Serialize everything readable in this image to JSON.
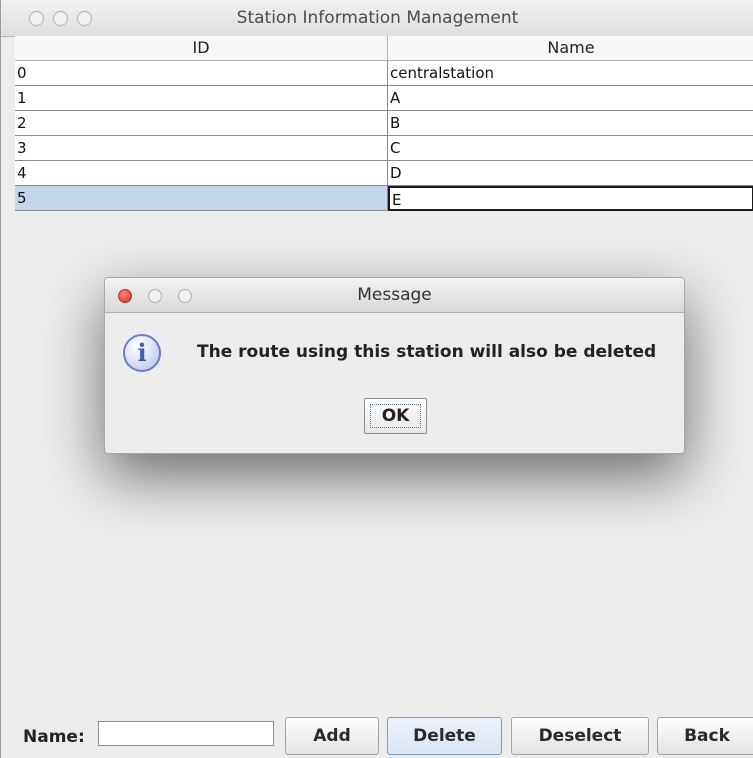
{
  "window": {
    "title": "Station Information Management"
  },
  "table": {
    "columns": [
      "ID",
      "Name"
    ],
    "rows": [
      {
        "id": "0",
        "name": "centralstation"
      },
      {
        "id": "1",
        "name": "A"
      },
      {
        "id": "2",
        "name": "B"
      },
      {
        "id": "3",
        "name": "C"
      },
      {
        "id": "4",
        "name": "D"
      },
      {
        "id": "5",
        "name": "E"
      }
    ],
    "selected_row": 5,
    "selection_color": "#c3d6ec"
  },
  "form": {
    "name_label": "Name:",
    "name_value": "",
    "add_label": "Add",
    "delete_label": "Delete",
    "deselect_label": "Deselect",
    "back_label": "Back"
  },
  "dialog": {
    "title": "Message",
    "icon": "info-icon",
    "message": "The route using this station will also be deleted",
    "ok_label": "OK"
  },
  "colors": {
    "close_button": "#e0463f",
    "info_icon": "#6e7cc9"
  }
}
